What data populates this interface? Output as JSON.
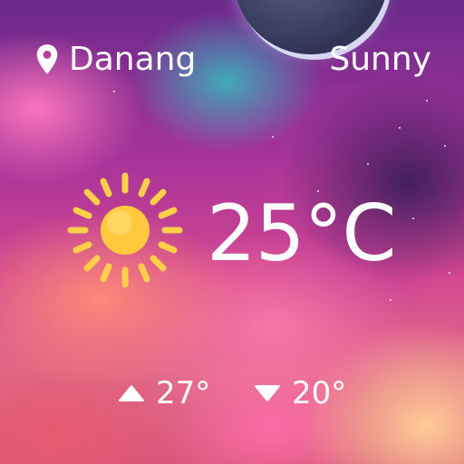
{
  "location": {
    "icon": "location-pin-icon",
    "city": "Danang"
  },
  "condition": {
    "text": "Sunny",
    "icon": "sun-icon"
  },
  "temperature": {
    "current": "25°C"
  },
  "forecast": {
    "high_icon": "arrow-up-triangle-icon",
    "high": "27°",
    "low_icon": "arrow-down-triangle-icon",
    "low": "20°"
  },
  "colors": {
    "text": "#ffffff",
    "sun": "#ffc83d",
    "sun_rays": "#ffcf4a"
  }
}
